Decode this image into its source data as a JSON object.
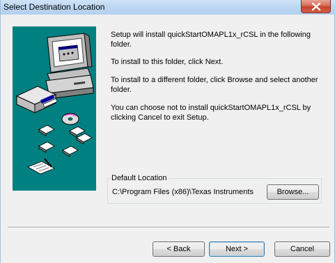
{
  "window": {
    "title": "Select Destination Location"
  },
  "icons": {
    "close": "close-icon",
    "art": "setup-computer-illustration"
  },
  "colors": {
    "art_background": "#008080",
    "title_bar": "#bfd8f1",
    "close_button": "#c7422b"
  },
  "message": {
    "p1": "Setup will install quickStartOMAPL1x_rCSL in the following folder.",
    "p2": "To install to this folder, click Next.",
    "p3": "To install to a different folder, click Browse and select another folder.",
    "p4": "You can choose not to install quickStartOMAPL1x_rCSL by clicking Cancel to exit Setup."
  },
  "default_location": {
    "label": "Default Location",
    "path": "C:\\Program Files (x86)\\Texas Instruments",
    "browse_label": "Browse..."
  },
  "buttons": {
    "back": "< Back",
    "next": "Next >",
    "cancel": "Cancel"
  }
}
